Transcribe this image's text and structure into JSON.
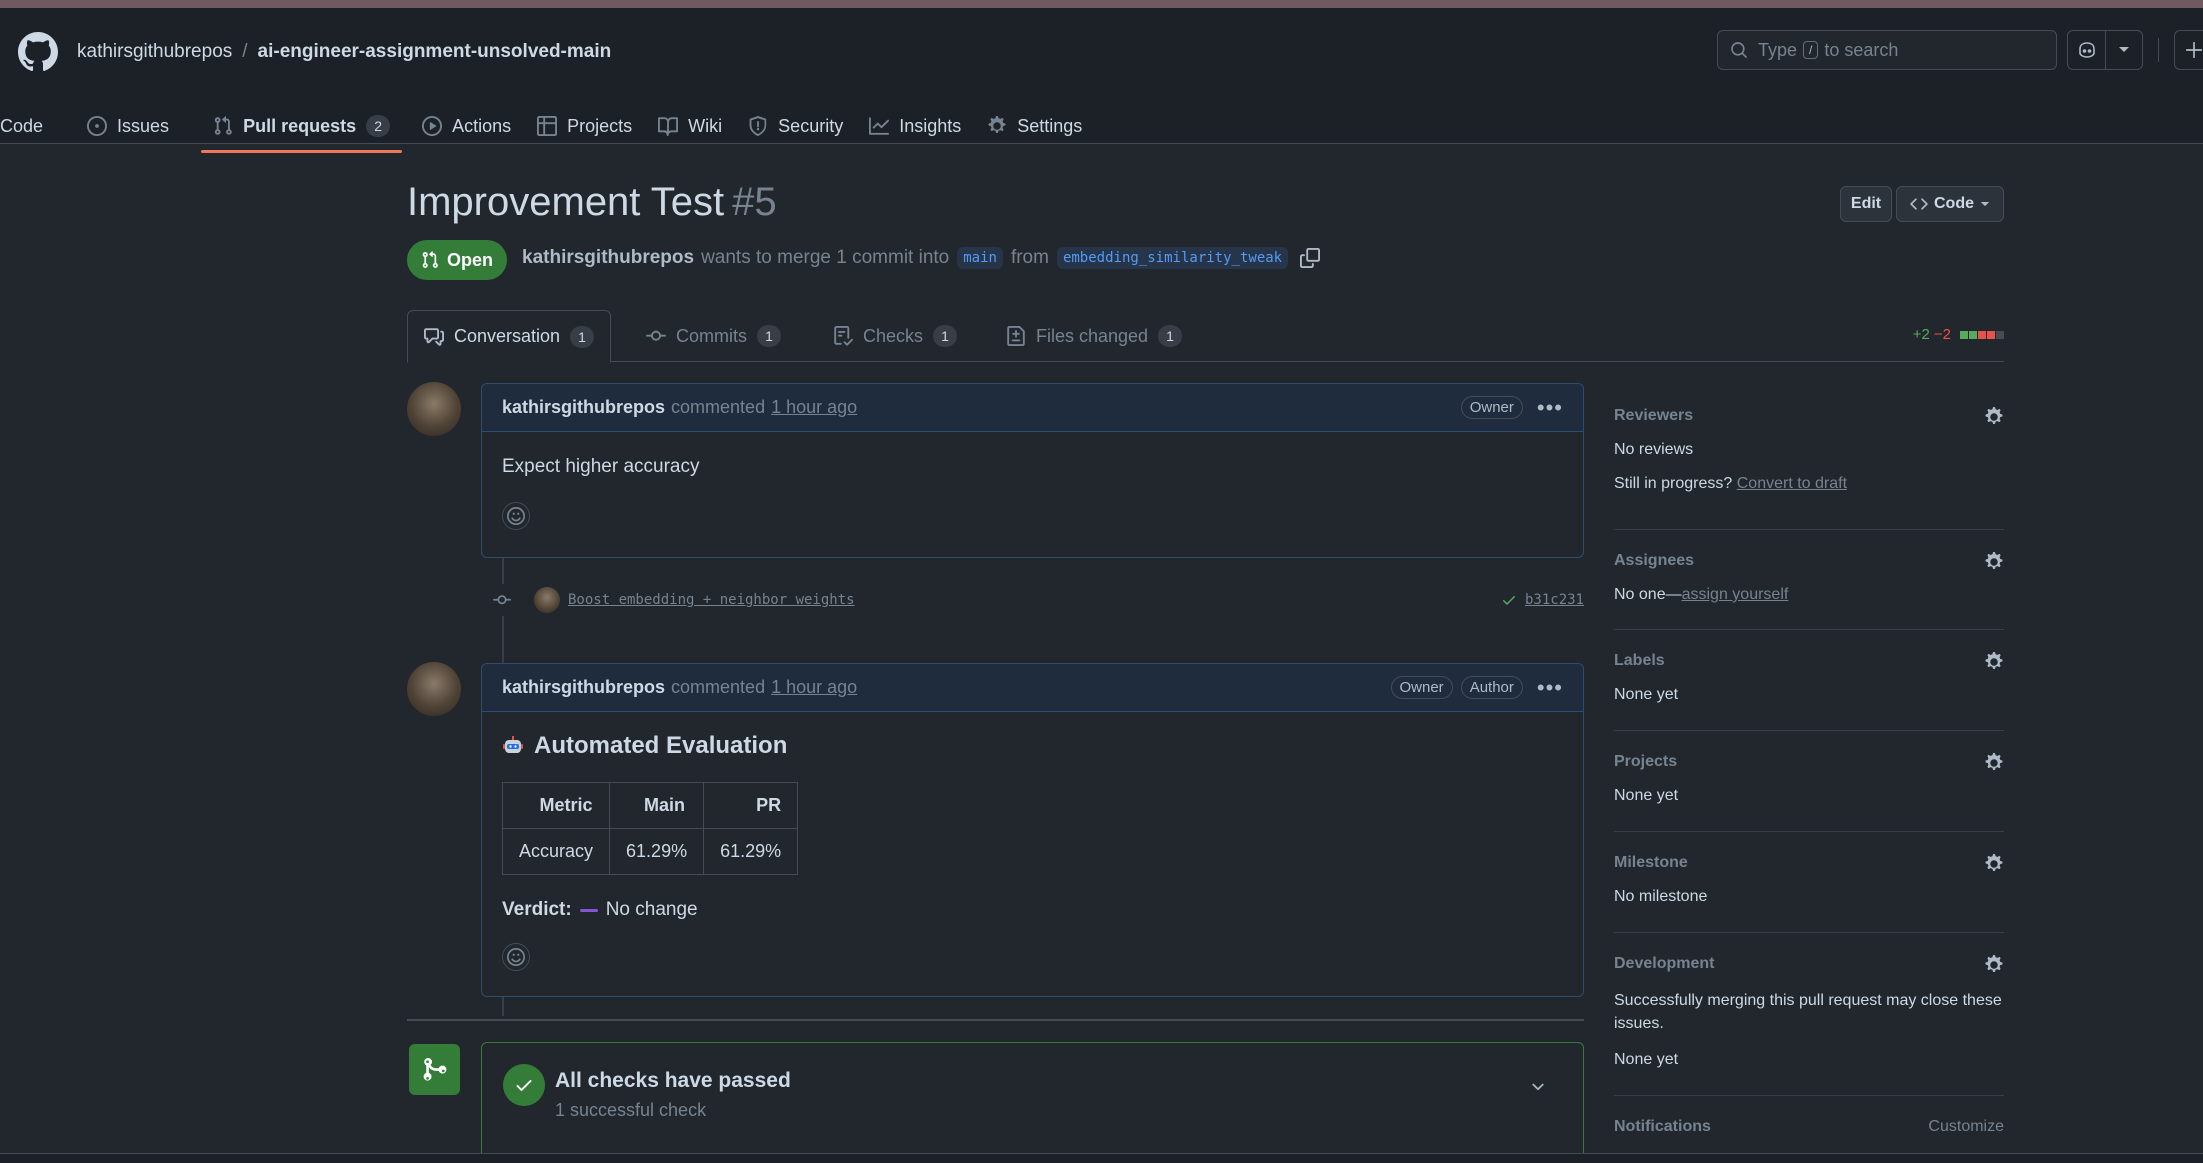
{
  "header": {
    "owner": "kathirsgithubrepos",
    "separator": "/",
    "repo": "ai-engineer-assignment-unsolved-main",
    "search_prefix": "Type",
    "search_key": "/",
    "search_suffix": "to search"
  },
  "repo_nav": [
    {
      "label": "Code",
      "icon": "code-icon"
    },
    {
      "label": "Issues",
      "icon": "issue-opened-icon"
    },
    {
      "label": "Pull requests",
      "icon": "git-pull-request-icon",
      "count": "2",
      "active": true
    },
    {
      "label": "Actions",
      "icon": "play-icon"
    },
    {
      "label": "Projects",
      "icon": "table-icon"
    },
    {
      "label": "Wiki",
      "icon": "book-icon"
    },
    {
      "label": "Security",
      "icon": "shield-icon"
    },
    {
      "label": "Insights",
      "icon": "graph-icon"
    },
    {
      "label": "Settings",
      "icon": "gear-icon"
    }
  ],
  "pr": {
    "title": "Improvement Test",
    "number": "#5",
    "edit_label": "Edit",
    "code_label": "Code",
    "state": "Open",
    "author": "kathirsgithubrepos",
    "merge_text": "wants to merge 1 commit into",
    "base_branch": "main",
    "from_text": "from",
    "head_branch": "embedding_similarity_tweak"
  },
  "tabs": [
    {
      "label": "Conversation",
      "count": "1",
      "active": true
    },
    {
      "label": "Commits",
      "count": "1"
    },
    {
      "label": "Checks",
      "count": "1"
    },
    {
      "label": "Files changed",
      "count": "1"
    }
  ],
  "diffstat": {
    "additions": "+2",
    "deletions": "−2"
  },
  "comment1": {
    "author": "kathirsgithubrepos",
    "verb": "commented",
    "time": "1 hour ago",
    "badge": "Owner",
    "body": "Expect higher accuracy"
  },
  "commit": {
    "message": "Boost embedding + neighbor weights",
    "sha": "b31c231"
  },
  "comment2": {
    "author": "kathirsgithubrepos",
    "verb": "commented",
    "time": "1 hour ago",
    "badge_owner": "Owner",
    "badge_author": "Author",
    "eval_title": "Automated Evaluation",
    "table": {
      "headers": [
        "Metric",
        "Main",
        "PR"
      ],
      "rows": [
        [
          "Accuracy",
          "61.29%",
          "61.29%"
        ]
      ]
    },
    "verdict_label": "Verdict:",
    "verdict_value": "No change"
  },
  "checks": {
    "title": "All checks have passed",
    "subtitle": "1 successful check"
  },
  "sidebar": {
    "reviewers_title": "Reviewers",
    "reviewers_value": "No reviews",
    "draft_prompt": "Still in progress?",
    "draft_link": "Convert to draft",
    "assignees_title": "Assignees",
    "assignees_value": "No one—",
    "assignees_link": "assign yourself",
    "labels_title": "Labels",
    "labels_value": "None yet",
    "projects_title": "Projects",
    "projects_value": "None yet",
    "milestone_title": "Milestone",
    "milestone_value": "No milestone",
    "development_title": "Development",
    "development_text": "Successfully merging this pull request may close these issues.",
    "development_value": "None yet",
    "notifications_title": "Notifications",
    "notifications_link": "Customize"
  },
  "colors": {
    "open_green": "#347d39",
    "active_tab_underline": "#ec775c",
    "link_blue": "#539bf5",
    "add_green": "#57ab5a",
    "del_red": "#e5534b"
  }
}
